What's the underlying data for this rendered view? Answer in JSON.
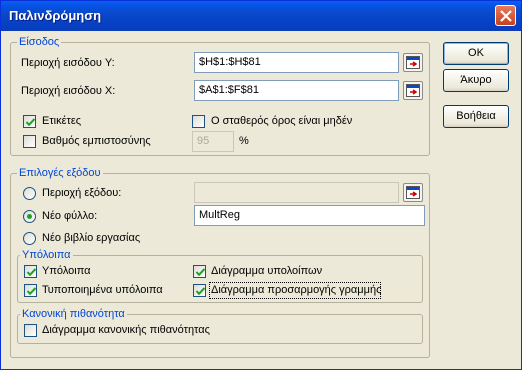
{
  "window": {
    "title": "Παλινδρόμηση"
  },
  "input_group": {
    "legend": "Είσοδος",
    "y_range_label": "Περιοχή εισόδου Y:",
    "y_range_value": "$H$1:$H$81",
    "x_range_label": "Περιοχή εισόδου X:",
    "x_range_value": "$A$1:$F$81",
    "labels_checkbox": {
      "label": "Ετικέτες",
      "checked": true
    },
    "const_zero_checkbox": {
      "label": "Ο σταθερός όρος είναι μηδέν",
      "checked": false
    },
    "confidence_checkbox": {
      "label": "Βαθμός εμπιστοσύνης",
      "checked": false
    },
    "confidence_value": "95",
    "percent_sign": "%"
  },
  "output_group": {
    "legend": "Επιλογές εξόδου",
    "output_range_label": "Περιοχή εξόδου:",
    "output_range_value": "",
    "new_sheet_label": "Νέο φύλλο:",
    "new_sheet_value": "MultReg",
    "new_workbook_label": "Νέο βιβλίο εργασίας",
    "selected_option": "new_sheet"
  },
  "residuals_group": {
    "legend": "Υπόλοιπα",
    "residuals": {
      "label": "Υπόλοιπα",
      "checked": true
    },
    "standardized": {
      "label": "Τυποποιημένα υπόλοιπα",
      "checked": true
    },
    "residual_plots": {
      "label": "Διάγραμμα υπολοίπων",
      "checked": true
    },
    "line_fit_plots": {
      "label": "Διάγραμμα προσαρμογής γραμμής",
      "checked": true
    }
  },
  "normal_group": {
    "legend": "Κανονική πιθανότητα",
    "normal_plot": {
      "label": "Διάγραμμα κανονικής πιθανότητας",
      "checked": false
    }
  },
  "buttons": {
    "ok": "OK",
    "cancel": "Άκυρο",
    "help": "Βοήθεια"
  },
  "icons": {
    "range_selector": "collapse-dialog-icon",
    "checkmark": "checkmark-icon",
    "close": "close-icon"
  },
  "colors": {
    "titlebar": "#0a47c9",
    "group_legend": "#0046d5",
    "checkmark": "#21a121",
    "dialog_bg": "#ece9d8"
  }
}
